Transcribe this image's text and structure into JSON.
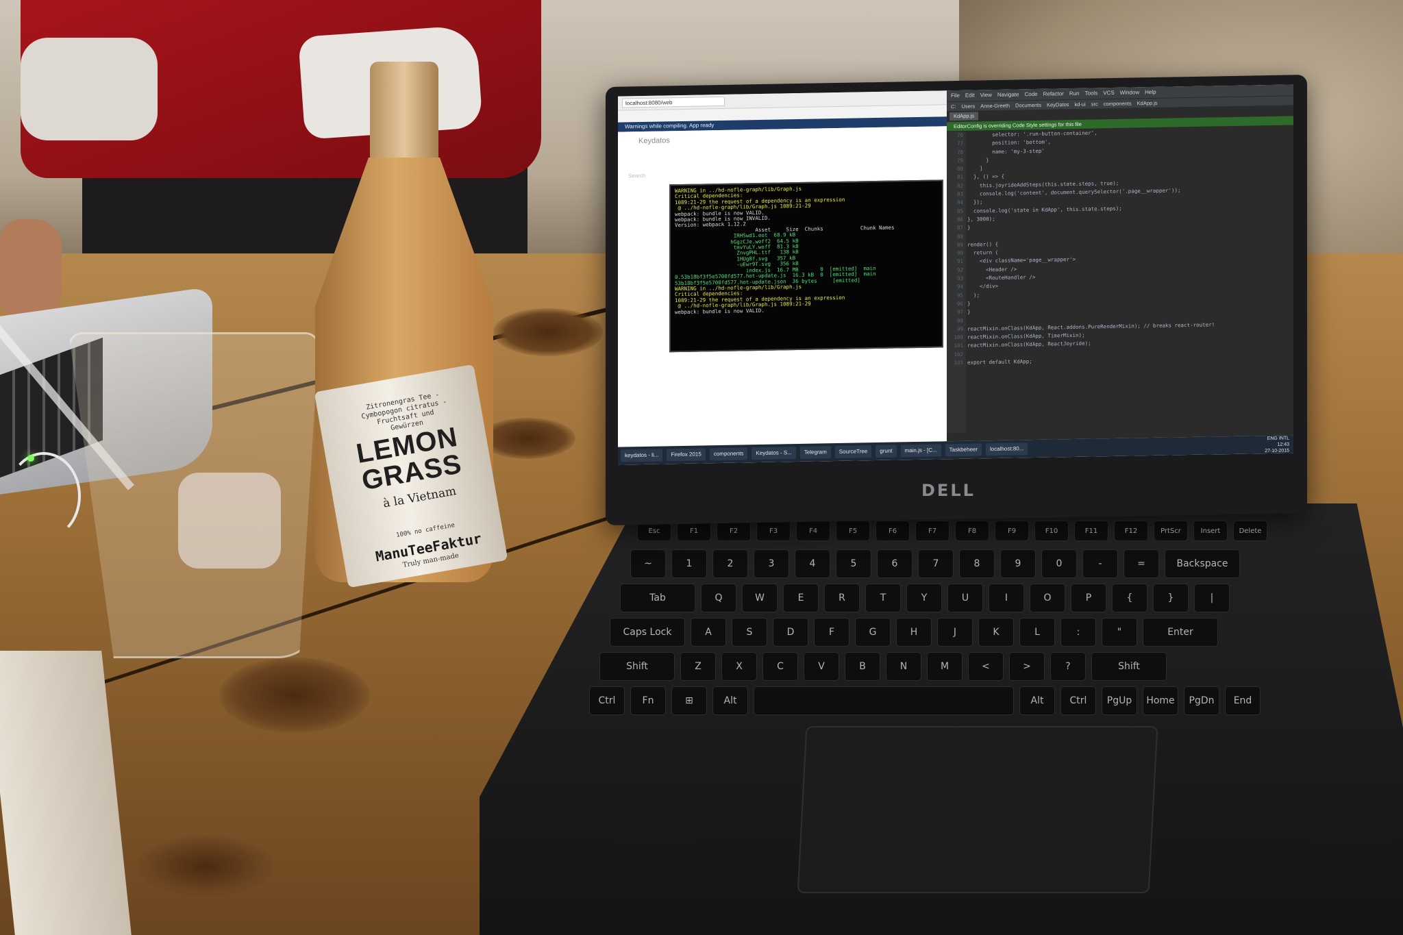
{
  "bottle": {
    "label_small": "Zitronengras Tee - Cymbopogon citratus - Fruchtsaft und Gewürzen",
    "label_main_1": "LEMON",
    "label_main_2": "GRASS",
    "label_sub": "à la Vietnam",
    "label_caffeine": "100% no caffeine",
    "label_brand": "ManuTeeFaktur",
    "label_tag": "Truly man-made"
  },
  "laptop": {
    "brand": "DELL",
    "keyboard": {
      "function_row": [
        "Esc",
        "F1",
        "F2",
        "F3",
        "F4",
        "F5",
        "F6",
        "F7",
        "F8",
        "F9",
        "F10",
        "F11",
        "F12",
        "PrtScr",
        "Insert",
        "Delete"
      ],
      "number_row": [
        "~",
        "1",
        "2",
        "3",
        "4",
        "5",
        "6",
        "7",
        "8",
        "9",
        "0",
        "-",
        "=",
        "Backspace"
      ],
      "top_row": [
        "Tab",
        "Q",
        "W",
        "E",
        "R",
        "T",
        "Y",
        "U",
        "I",
        "O",
        "P",
        "{",
        "}",
        "|"
      ],
      "home_row": [
        "Caps Lock",
        "A",
        "S",
        "D",
        "F",
        "G",
        "H",
        "J",
        "K",
        "L",
        ":",
        "\"",
        "Enter"
      ],
      "bottom_row": [
        "Shift",
        "Z",
        "X",
        "C",
        "V",
        "B",
        "N",
        "M",
        "<",
        ">",
        "?",
        "Shift"
      ],
      "mod_row": [
        "Ctrl",
        "Fn",
        "⊞",
        "Alt",
        "",
        "Alt",
        "Ctrl",
        "PgUp",
        "Home",
        "PgDn",
        "End"
      ]
    },
    "screen": {
      "browser_tab": "localhost:8080/web",
      "toast": "Warnings while compiling. App ready",
      "app_title": "Keydatos",
      "app_search": "Search",
      "terminal_lines": [
        {
          "t": "WARNING in ../hd-nofle-graph/lib/Graph.js",
          "c": ""
        },
        {
          "t": "Critical dependencies:",
          "c": ""
        },
        {
          "t": "1089:21-29 the request of a dependency is an expression",
          "c": ""
        },
        {
          "t": " @ ../hd-nofle-graph/lib/Graph.js 1089:21-29",
          "c": ""
        },
        {
          "t": "webpack: bundle is now VALID.",
          "c": "w"
        },
        {
          "t": "webpack: bundle is now INVALID.",
          "c": "w"
        },
        {
          "t": "Version: webpack 1.12.2",
          "c": "w"
        },
        {
          "t": "                          Asset     Size  Chunks            Chunk Names",
          "c": "w"
        },
        {
          "t": "                   IRHSwd1.eot  68.9 kB",
          "c": "g"
        },
        {
          "t": "                  hGgzCJe.woff2  64.5 kB",
          "c": "g"
        },
        {
          "t": "                   tmvYuLY.woff  81.3 kB",
          "c": "g"
        },
        {
          "t": "                    ZnvgPHL.ttf   138 kB",
          "c": "g"
        },
        {
          "t": "                    1HUg8f.svg   357 kB",
          "c": "g"
        },
        {
          "t": "                    -uEwr9T.svg   356 kB",
          "c": "g"
        },
        {
          "t": "                       index.js  16.7 MB       0  [emitted]  main",
          "c": "g"
        },
        {
          "t": "0.53b18bf3f5e5700fd577.hot-update.js  16.3 kB  0  [emitted]  main",
          "c": "g"
        },
        {
          "t": "53b18bf3f5e5700fd577.hot-update.json  36 bytes     [emitted]",
          "c": "g"
        },
        {
          "t": "WARNING in ../hd-nofle-graph/lib/Graph.js",
          "c": ""
        },
        {
          "t": "Critical dependencies:",
          "c": ""
        },
        {
          "t": "1089:21-29 the request of a dependency is an expression",
          "c": ""
        },
        {
          "t": " @ ../hd-nofle-graph/lib/Graph.js 1089:21-29",
          "c": ""
        },
        {
          "t": "webpack: bundle is now VALID.",
          "c": "w"
        }
      ],
      "ide_menu": [
        "File",
        "Edit",
        "View",
        "Navigate",
        "Code",
        "Refactor",
        "Run",
        "Tools",
        "VCS",
        "Window",
        "Help"
      ],
      "ide_nav": [
        "C:",
        "Users",
        "Anne-Greeth",
        "Documents",
        "KeyDatos",
        "kd-ui",
        "src",
        "components",
        "KdApp.js"
      ],
      "ide_tab": "KdApp.js",
      "ide_banner": "EditorConfig is overriding Code Style settings for this file",
      "code_lines": [
        {
          "n": "76",
          "t": "        selector: '.run-button-container',"
        },
        {
          "n": "77",
          "t": "        position: 'bottom',"
        },
        {
          "n": "78",
          "t": "        name: 'my-3-step'"
        },
        {
          "n": "79",
          "t": "      }"
        },
        {
          "n": "80",
          "t": "    ]"
        },
        {
          "n": "81",
          "t": "  }, () => {"
        },
        {
          "n": "82",
          "t": "    this.joyrideAddSteps(this.state.steps, true);"
        },
        {
          "n": "83",
          "t": "    console.log('content', document.querySelector('.page__wrapper'));"
        },
        {
          "n": "84",
          "t": "  });"
        },
        {
          "n": "85",
          "t": "  console.log('state in KdApp', this.state.steps);"
        },
        {
          "n": "86",
          "t": "}, 3000);"
        },
        {
          "n": "87",
          "t": "}"
        },
        {
          "n": "88",
          "t": ""
        },
        {
          "n": "89",
          "t": "render() {"
        },
        {
          "n": "90",
          "t": "  return ("
        },
        {
          "n": "91",
          "t": "    <div className='page__wrapper'>"
        },
        {
          "n": "92",
          "t": "      <Header />"
        },
        {
          "n": "93",
          "t": "      <RouteHandler />"
        },
        {
          "n": "94",
          "t": "    </div>"
        },
        {
          "n": "95",
          "t": "  );"
        },
        {
          "n": "96",
          "t": "}"
        },
        {
          "n": "97",
          "t": "}"
        },
        {
          "n": "98",
          "t": ""
        },
        {
          "n": "99",
          "t": "reactMixin.onClass(KdApp, React.addons.PureRenderMixin); // breaks react-router!"
        },
        {
          "n": "100",
          "t": "reactMixin.onClass(KdApp, TimerMixin);"
        },
        {
          "n": "101",
          "t": "reactMixin.onClass(KdApp, ReactJoyride);"
        },
        {
          "n": "102",
          "t": ""
        },
        {
          "n": "103",
          "t": "export default KdApp;"
        }
      ],
      "taskbar_items": [
        "keydatos - li...",
        "Firefox 2015",
        "components",
        "Keydatos - S...",
        "Telegram",
        "SourceTree",
        "grunt",
        "main.js - [C...",
        "Taskbeheer",
        "localhost:80..."
      ],
      "tray_time": "12:43",
      "tray_date": "27-10-2015",
      "tray_lang": "ENG INTL"
    }
  }
}
